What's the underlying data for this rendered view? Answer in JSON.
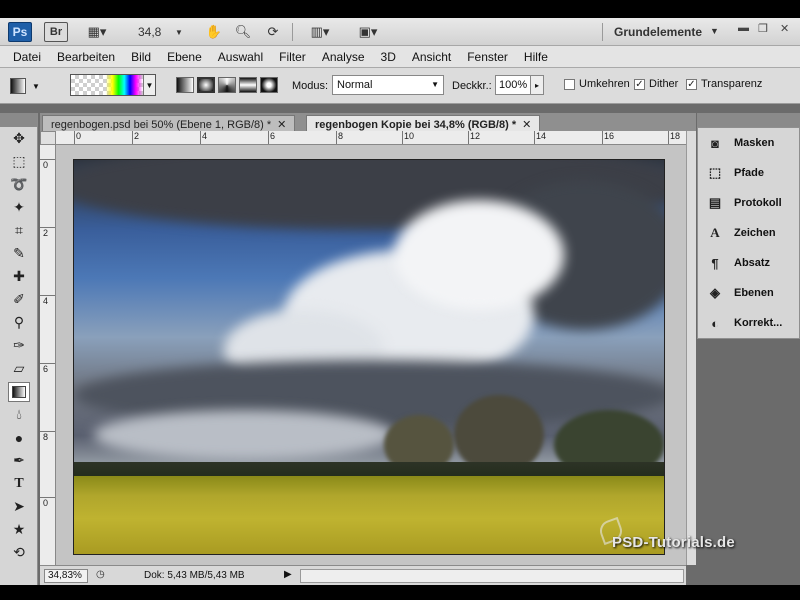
{
  "appbar": {
    "ps_logo": "Ps",
    "br_logo": "Br",
    "zoom": "34,8",
    "workspace": "Grundelemente"
  },
  "menu": [
    "Datei",
    "Bearbeiten",
    "Bild",
    "Ebene",
    "Auswahl",
    "Filter",
    "Analyse",
    "3D",
    "Ansicht",
    "Fenster",
    "Hilfe"
  ],
  "options": {
    "modus_label": "Modus:",
    "modus_value": "Normal",
    "deckkraft_label": "Deckkr.:",
    "deckkraft_value": "100%",
    "umkehren": {
      "label": "Umkehren",
      "checked": false
    },
    "dither": {
      "label": "Dither",
      "checked": true
    },
    "transparenz": {
      "label": "Transparenz",
      "checked": true
    }
  },
  "tabs": [
    {
      "label": "regenbogen.psd bei 50% (Ebene 1, RGB/8) *",
      "active": false
    },
    {
      "label": "regenbogen Kopie bei 34,8% (RGB/8) *",
      "active": true
    }
  ],
  "ruler_h": [
    "0",
    "2",
    "4",
    "6",
    "8",
    "10",
    "12",
    "14",
    "16",
    "18"
  ],
  "ruler_v": [
    "0",
    "2",
    "4",
    "6",
    "8",
    "0"
  ],
  "panels": [
    {
      "label": "Masken",
      "icon": "masks-icon"
    },
    {
      "label": "Pfade",
      "icon": "paths-icon"
    },
    {
      "label": "Protokoll",
      "icon": "history-icon"
    },
    {
      "label": "Zeichen",
      "icon": "character-icon"
    },
    {
      "label": "Absatz",
      "icon": "paragraph-icon"
    },
    {
      "label": "Ebenen",
      "icon": "layers-icon"
    },
    {
      "label": "Korrekt...",
      "icon": "adjustments-icon"
    }
  ],
  "status": {
    "zoom": "34,83%",
    "doc": "Dok: 5,43 MB/5,43 MB"
  },
  "watermark": "PSD-Tutorials.de"
}
